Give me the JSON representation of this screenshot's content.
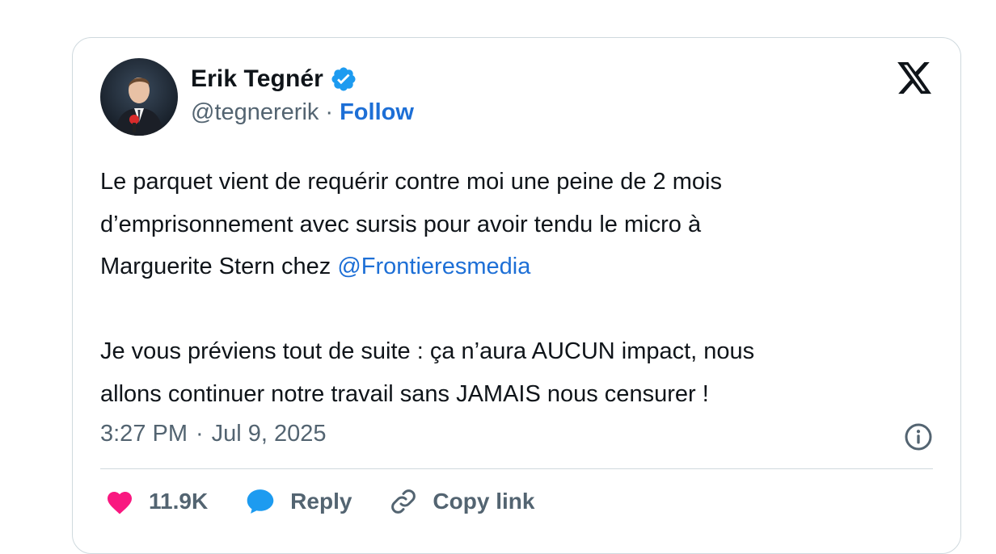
{
  "author": {
    "display_name": "Erik Tegnér",
    "handle": "@tegnererik",
    "separator": "·",
    "follow_label": "Follow",
    "avatar_icon": "avatar-photo",
    "verified_icon": "verified-badge-icon"
  },
  "tweet": {
    "line1": "Le parquet vient de requérir contre moi une peine de 2 mois",
    "line2": "d’emprisonnement avec sursis pour avoir tendu le micro à",
    "line3_prefix": "Marguerite Stern chez ",
    "mention": "@Frontieresmedia",
    "line4": "Je vous préviens tout de suite : ça n’aura AUCUN impact, nous",
    "line5": "allons continuer notre travail sans JAMAIS nous censurer !"
  },
  "meta": {
    "time": "3:27 PM",
    "separator": "·",
    "date": "Jul 9, 2025"
  },
  "actions": {
    "like_count": "11.9K",
    "reply_label": "Reply",
    "copy_label": "Copy link"
  },
  "colors": {
    "link_blue": "#1d6fd6",
    "like_pink": "#f91880",
    "reply_blue": "#1d9bf0",
    "muted": "#536471",
    "border": "#cfd9de"
  },
  "icons": {
    "logo": "x-logo-icon",
    "info": "info-icon",
    "like": "heart-icon",
    "reply": "speech-bubble-icon",
    "copy": "link-icon"
  }
}
